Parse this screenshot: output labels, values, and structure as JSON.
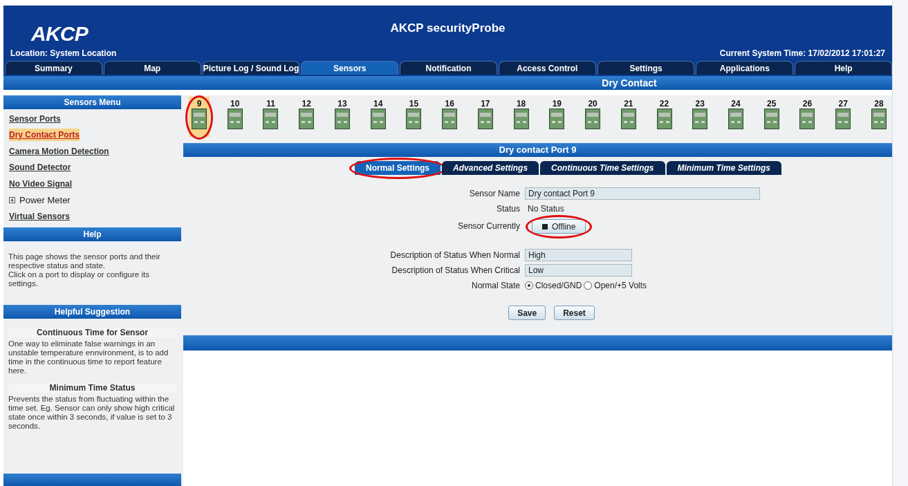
{
  "header": {
    "logo": "AKCP",
    "title": "AKCP securityProbe",
    "location": "Location: System Location",
    "time": "Current System Time: 17/02/2012 17:01:27"
  },
  "nav_tabs": [
    {
      "label": "Summary",
      "selected": false
    },
    {
      "label": "Map",
      "selected": false
    },
    {
      "label": "Picture Log / Sound Log",
      "selected": false
    },
    {
      "label": "Sensors",
      "selected": true
    },
    {
      "label": "Notification",
      "selected": false
    },
    {
      "label": "Access Control",
      "selected": false
    },
    {
      "label": "Settings",
      "selected": false
    },
    {
      "label": "Applications",
      "selected": false
    },
    {
      "label": "Help",
      "selected": false
    }
  ],
  "section_title": "Dry Contact",
  "sidebar": {
    "menu_title": "Sensors Menu",
    "items": [
      {
        "kind": "link",
        "label": "Sensor Ports",
        "selected": false
      },
      {
        "kind": "link",
        "label": "Dry Contact Ports",
        "selected": true
      },
      {
        "kind": "link",
        "label": "Camera Motion Detection",
        "selected": false
      },
      {
        "kind": "link",
        "label": "Sound Detector",
        "selected": false
      },
      {
        "kind": "link",
        "label": "No Video Signal",
        "selected": false
      },
      {
        "kind": "expandable",
        "label": "Power Meter",
        "selected": false,
        "expanded": false
      },
      {
        "kind": "link",
        "label": "Virtual Sensors",
        "selected": false
      }
    ],
    "help_title": "Help",
    "help_lines": [
      "This page shows the sensor ports and their respective status and state.",
      "Click on a port to display or configure its settings."
    ],
    "suggestion_title": "Helpful Suggestion",
    "tips": [
      {
        "title": "Continuous Time for Sensor",
        "text": "One way to eliminate false warnings in an unstable temperature ennvironment, is to add time in the continuous time to report feature here."
      },
      {
        "title": "Minimum Time Status",
        "text": "Prevents the status from fluctuating within the time set. Eg. Sensor can only show high critical state once within 3 seconds, if value is set to 3 seconds."
      }
    ]
  },
  "ports": [
    {
      "label": "9",
      "selected": true,
      "circled": true
    },
    {
      "label": "10",
      "selected": false,
      "circled": false
    },
    {
      "label": "11",
      "selected": false,
      "circled": false
    },
    {
      "label": "12",
      "selected": false,
      "circled": false
    },
    {
      "label": "13",
      "selected": false,
      "circled": false
    },
    {
      "label": "14",
      "selected": false,
      "circled": false
    },
    {
      "label": "15",
      "selected": false,
      "circled": false
    },
    {
      "label": "16",
      "selected": false,
      "circled": false
    },
    {
      "label": "17",
      "selected": false,
      "circled": false
    },
    {
      "label": "18",
      "selected": false,
      "circled": false
    },
    {
      "label": "19",
      "selected": false,
      "circled": false
    },
    {
      "label": "20",
      "selected": false,
      "circled": false
    },
    {
      "label": "21",
      "selected": false,
      "circled": false
    },
    {
      "label": "22",
      "selected": false,
      "circled": false
    },
    {
      "label": "23",
      "selected": false,
      "circled": false
    },
    {
      "label": "24",
      "selected": false,
      "circled": false
    },
    {
      "label": "25",
      "selected": false,
      "circled": false
    },
    {
      "label": "26",
      "selected": false,
      "circled": false
    },
    {
      "label": "27",
      "selected": false,
      "circled": false
    },
    {
      "label": "28",
      "selected": false,
      "circled": false
    }
  ],
  "port_title": "Dry contact Port 9",
  "settings_tabs": [
    {
      "label": "Normal Settings",
      "selected": true,
      "circled": true
    },
    {
      "label": "Advanced Settings",
      "selected": false,
      "circled": false
    },
    {
      "label": "Continuous Time Settings",
      "selected": false,
      "circled": false
    },
    {
      "label": "Minimum Time Settings",
      "selected": false,
      "circled": false
    }
  ],
  "form": {
    "sensor_name": {
      "label": "Sensor Name",
      "value": "Dry contact Port 9"
    },
    "status": {
      "label": "Status",
      "value": "No Status"
    },
    "sensor_currently": {
      "label": "Sensor Currently",
      "button": "Offline",
      "circled": true
    },
    "desc_normal": {
      "label": "Description of Status When Normal",
      "value": "High"
    },
    "desc_critical": {
      "label": "Description of Status When Critical",
      "value": "Low"
    },
    "normal_state": {
      "label": "Normal State",
      "options": [
        {
          "label": "Closed/GND",
          "selected": true
        },
        {
          "label": "Open/+5 Volts",
          "selected": false
        }
      ]
    },
    "buttons": [
      "Save",
      "Reset"
    ]
  }
}
